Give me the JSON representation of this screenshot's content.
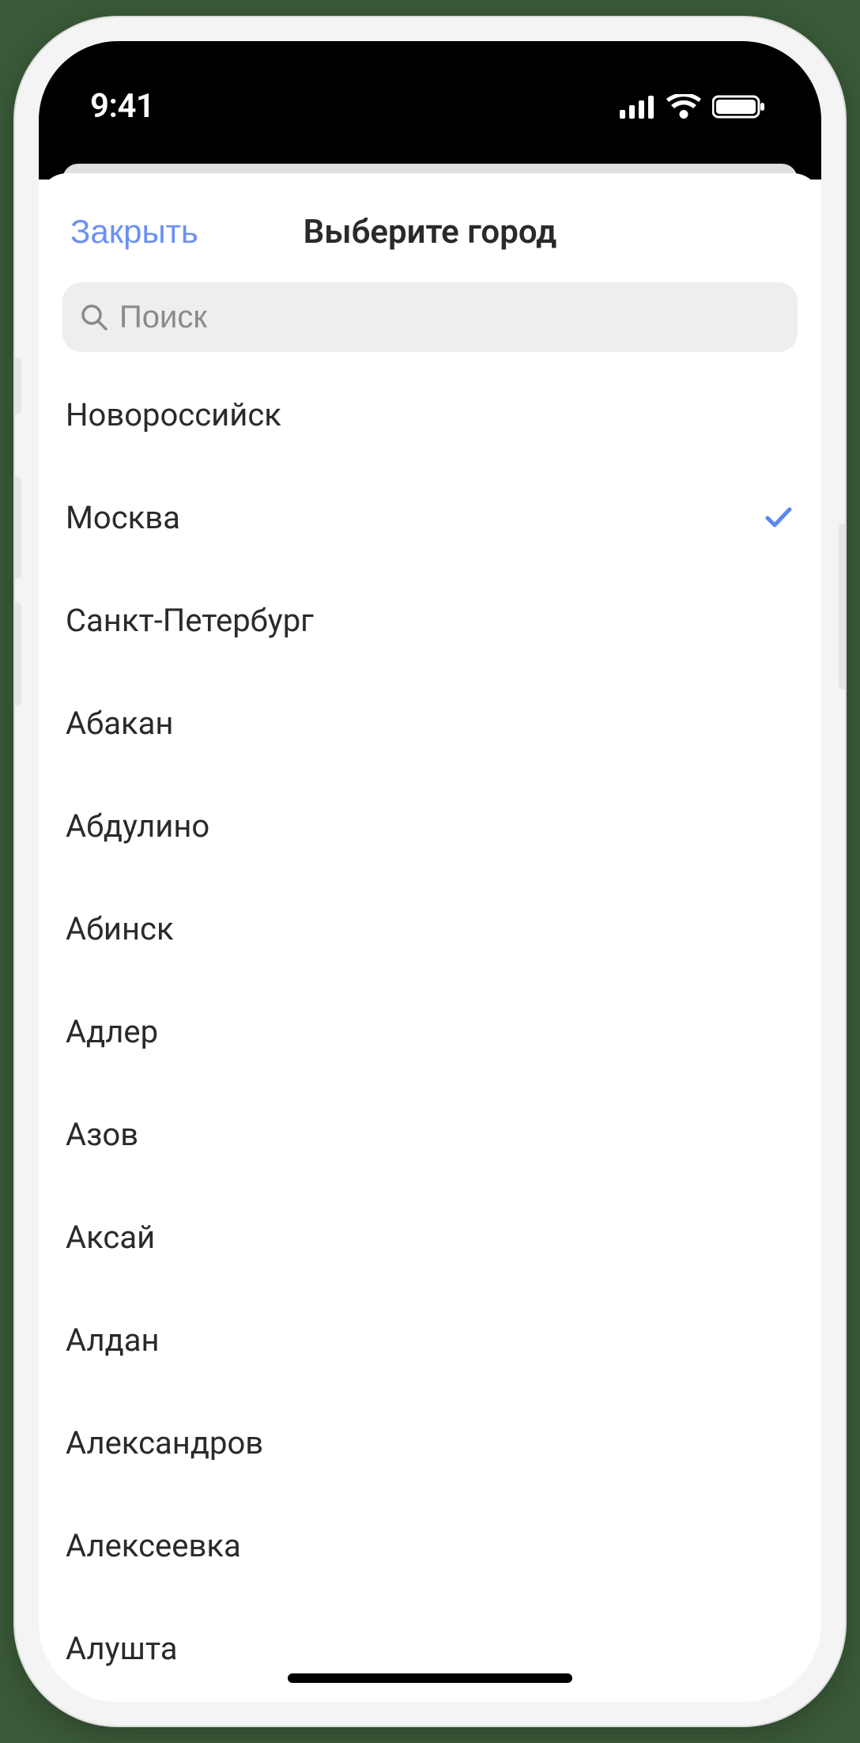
{
  "status": {
    "time": "9:41"
  },
  "nav": {
    "close": "Закрыть",
    "title": "Выберите город"
  },
  "search": {
    "placeholder": "Поиск",
    "value": ""
  },
  "cities": [
    {
      "name": "Новороссийск",
      "selected": false
    },
    {
      "name": "Москва",
      "selected": true
    },
    {
      "name": "Санкт-Петербург",
      "selected": false
    },
    {
      "name": "Абакан",
      "selected": false
    },
    {
      "name": "Абдулино",
      "selected": false
    },
    {
      "name": "Абинск",
      "selected": false
    },
    {
      "name": "Адлер",
      "selected": false
    },
    {
      "name": "Азов",
      "selected": false
    },
    {
      "name": "Аксай",
      "selected": false
    },
    {
      "name": "Алдан",
      "selected": false
    },
    {
      "name": "Александров",
      "selected": false
    },
    {
      "name": "Алексеевка",
      "selected": false
    },
    {
      "name": "Алушта",
      "selected": false
    }
  ]
}
